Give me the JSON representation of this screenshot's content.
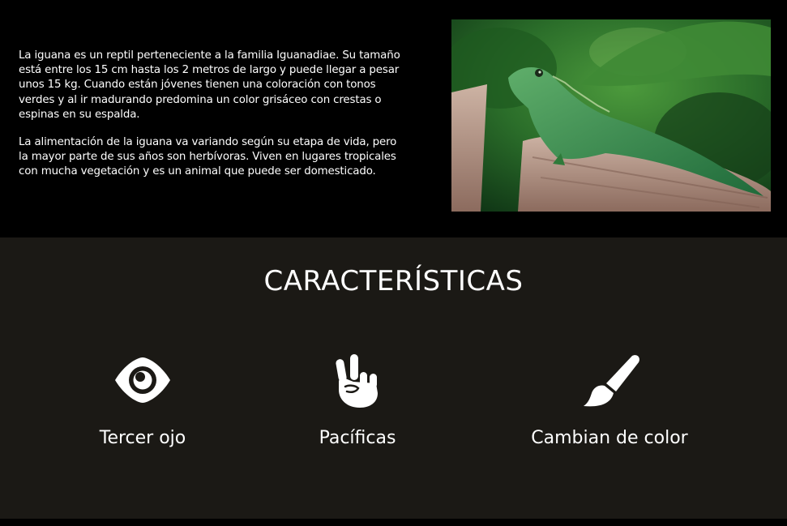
{
  "intro": {
    "paragraphs": [
      "La iguana es un reptil perteneciente a la familia Iguanadiae. Su tamaño está entre los 15 cm hasta los 2 metros de largo y puede llegar a pesar unos 15 kg. Cuando están jóvenes tienen una coloración con tonos verdes y al ir madurando predomina un color grisáceo con crestas o espinas en su espalda.",
      "La alimentación de la iguana va variando según su etapa de vida, pero la mayor parte de sus años son herbívoras. Viven en lugares tropicales con mucha vegetación y es un animal que puede ser domesticado."
    ]
  },
  "features": {
    "title": "CARACTERÍSTICAS",
    "items": [
      {
        "label": "Tercer ojo",
        "icon": "eye-icon"
      },
      {
        "label": "Pacíficas",
        "icon": "peace-hand-icon"
      },
      {
        "label": "Cambian de color",
        "icon": "paintbrush-icon"
      }
    ]
  },
  "colors": {
    "background": "#000000",
    "features_background": "#1b1915",
    "text": "#ffffff"
  }
}
